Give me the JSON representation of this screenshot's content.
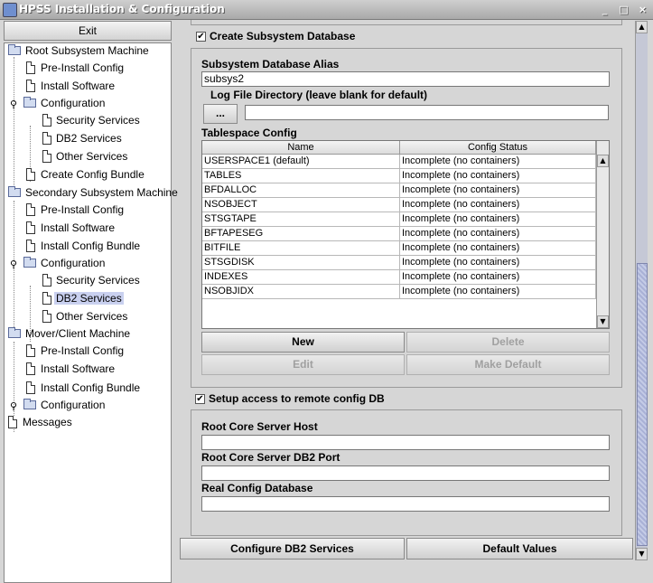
{
  "window": {
    "title": "HPSS Installation & Configuration",
    "controls": {
      "minimize": "_",
      "maximize": "□",
      "close": "×"
    }
  },
  "left_panel": {
    "exit_label": "Exit",
    "tree": [
      {
        "label": "Root Subsystem Machine",
        "icon": "folder-icon",
        "level": 0
      },
      {
        "label": "Pre-Install Config",
        "icon": "document-icon",
        "level": 1
      },
      {
        "label": "Install Software",
        "icon": "document-icon",
        "level": 1
      },
      {
        "label": "Configuration",
        "icon": "folder-icon",
        "level": 1,
        "expanded": true
      },
      {
        "label": "Security Services",
        "icon": "document-icon",
        "level": 2
      },
      {
        "label": "DB2 Services",
        "icon": "document-icon",
        "level": 2
      },
      {
        "label": "Other Services",
        "icon": "document-icon",
        "level": 2
      },
      {
        "label": "Create Config Bundle",
        "icon": "document-icon",
        "level": 1
      },
      {
        "label": "Secondary Subsystem Machine",
        "icon": "folder-icon",
        "level": 0
      },
      {
        "label": "Pre-Install Config",
        "icon": "document-icon",
        "level": 1
      },
      {
        "label": "Install Software",
        "icon": "document-icon",
        "level": 1
      },
      {
        "label": "Install Config Bundle",
        "icon": "document-icon",
        "level": 1
      },
      {
        "label": "Configuration",
        "icon": "folder-icon",
        "level": 1,
        "expanded": true
      },
      {
        "label": "Security Services",
        "icon": "document-icon",
        "level": 2
      },
      {
        "label": "DB2 Services",
        "icon": "document-icon",
        "level": 2,
        "selected": true
      },
      {
        "label": "Other Services",
        "icon": "document-icon",
        "level": 2
      },
      {
        "label": "Mover/Client Machine",
        "icon": "folder-icon",
        "level": 0
      },
      {
        "label": "Pre-Install Config",
        "icon": "document-icon",
        "level": 1
      },
      {
        "label": "Install Software",
        "icon": "document-icon",
        "level": 1
      },
      {
        "label": "Install Config Bundle",
        "icon": "document-icon",
        "level": 1
      },
      {
        "label": "Configuration",
        "icon": "folder-icon",
        "level": 1,
        "expanded": false
      },
      {
        "label": "Messages",
        "icon": "document-icon",
        "level": 0
      }
    ]
  },
  "main": {
    "create_db": {
      "label": "Create Subsystem Database",
      "checked": true
    },
    "alias": {
      "label": "Subsystem Database Alias",
      "value": "subsys2"
    },
    "log_dir": {
      "label": "Log File Directory (leave blank for default)",
      "browse_label": "...",
      "value": ""
    },
    "tablespace": {
      "label": "Tablespace Config",
      "columns": [
        "Name",
        "Config Status"
      ],
      "rows": [
        [
          "USERSPACE1 (default)",
          "Incomplete (no containers)"
        ],
        [
          "TABLES",
          "Incomplete (no containers)"
        ],
        [
          "BFDALLOC",
          "Incomplete (no containers)"
        ],
        [
          "NSOBJECT",
          "Incomplete (no containers)"
        ],
        [
          "STSGTAPE",
          "Incomplete (no containers)"
        ],
        [
          "BFTAPESEG",
          "Incomplete (no containers)"
        ],
        [
          "BITFILE",
          "Incomplete (no containers)"
        ],
        [
          "STSGDISK",
          "Incomplete (no containers)"
        ],
        [
          "INDEXES",
          "Incomplete (no containers)"
        ],
        [
          "NSOBJIDX",
          "Incomplete (no containers)"
        ]
      ],
      "buttons": {
        "new": "New",
        "delete": "Delete",
        "edit": "Edit",
        "make_default": "Make Default"
      }
    },
    "remote": {
      "label": "Setup access to remote config DB",
      "checked": true,
      "host_label": "Root Core Server Host",
      "host_value": "",
      "port_label": "Root Core Server DB2 Port",
      "port_value": "",
      "realdb_label": "Real Config Database",
      "realdb_value": ""
    }
  },
  "bottom": {
    "configure_label": "Configure DB2 Services",
    "defaults_label": "Default Values"
  }
}
